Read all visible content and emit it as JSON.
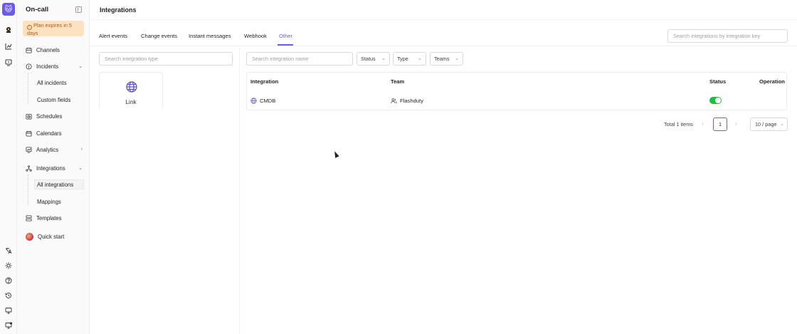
{
  "app": {
    "logo_icon": "cat-logo-icon",
    "section": "On-call",
    "plan_notice": "Plan expires in 5 days",
    "accent_color": "#6c5ce7",
    "plan_bg_color": "#fde2c2"
  },
  "rail": {
    "top_icons": [
      "user-badge-icon",
      "chart-icon",
      "monitor-alert-icon"
    ],
    "bottom_icons": [
      "translate-icon",
      "sun-icon",
      "help-icon",
      "history-icon",
      "desktop-icon",
      "desktop-alert-icon"
    ]
  },
  "sidebar": {
    "items": [
      {
        "label": "Channels",
        "icon": "channels-icon"
      },
      {
        "label": "Incidents",
        "icon": "alert-icon",
        "chevron": "⌄"
      },
      {
        "label": "All incidents",
        "sub": true
      },
      {
        "label": "Custom fields",
        "sub": true
      },
      {
        "label": "Schedules",
        "icon": "schedule-icon"
      },
      {
        "label": "Calendars",
        "icon": "calendar-icon"
      },
      {
        "label": "Analytics",
        "icon": "analytics-icon",
        "chevron": "›"
      },
      {
        "label": "Integrations",
        "icon": "integrations-icon",
        "chevron": "⌄"
      },
      {
        "label": "All integrations",
        "sub": true,
        "active": true
      },
      {
        "label": "Mappings",
        "sub": true
      },
      {
        "label": "Templates",
        "icon": "templates-icon"
      },
      {
        "label": "Quick start",
        "icon": "avatar"
      }
    ]
  },
  "header": {
    "title": "Integrations"
  },
  "tabs": [
    {
      "label": "Alert events"
    },
    {
      "label": "Change events"
    },
    {
      "label": "Instant messages"
    },
    {
      "label": "Webhook"
    },
    {
      "label": "Other",
      "active": true
    }
  ],
  "search": {
    "integration_key_placeholder": "Search integrations by integration key",
    "integration_type_placeholder": "Search integration type",
    "integration_name_placeholder": "Search integration name"
  },
  "filters": [
    {
      "label": "Status"
    },
    {
      "label": "Type"
    },
    {
      "label": "Teams"
    }
  ],
  "integration_types": [
    {
      "label": "Link",
      "icon": "globe-icon"
    }
  ],
  "table": {
    "columns": [
      "Integration",
      "Team",
      "Status",
      "Operation"
    ],
    "rows": [
      {
        "integration": "CMDB",
        "integration_icon": "globe-icon",
        "team": "Flashduty",
        "team_icon": "users-icon",
        "status_on": true,
        "status_color": "#1bbf44"
      }
    ]
  },
  "pagination": {
    "total": "Total 1 items",
    "current_page": "1",
    "page_size": "10 / page"
  }
}
